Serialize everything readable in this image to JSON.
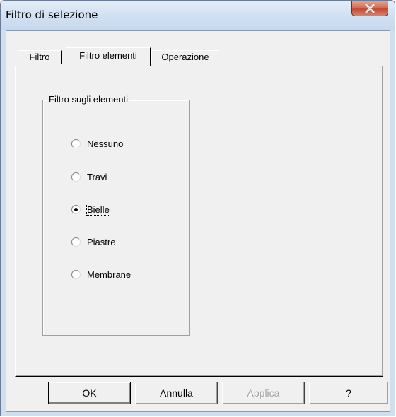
{
  "window": {
    "title": "Filtro di selezione",
    "close_icon": "close-x-icon"
  },
  "tabs": [
    {
      "label": "Filtro",
      "active": false
    },
    {
      "label": "Filtro elementi",
      "active": true
    },
    {
      "label": "Operazione",
      "active": false
    }
  ],
  "group": {
    "title": "Filtro sugli elementi",
    "options": [
      {
        "label": "Nessuno",
        "selected": false
      },
      {
        "label": "Travi",
        "selected": false
      },
      {
        "label": "Bielle",
        "selected": true
      },
      {
        "label": "Piastre",
        "selected": false
      },
      {
        "label": "Membrane",
        "selected": false
      }
    ]
  },
  "buttons": {
    "ok": "OK",
    "cancel": "Annulla",
    "apply": "Applica",
    "help": "?"
  }
}
